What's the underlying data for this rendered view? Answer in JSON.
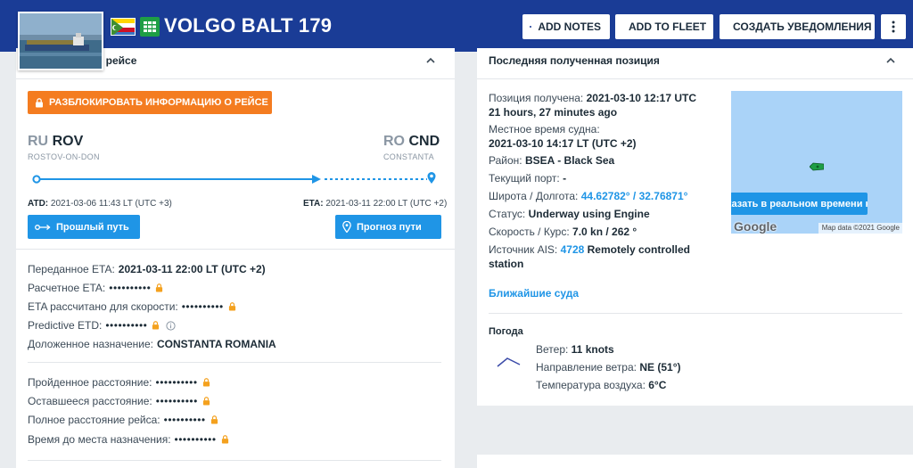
{
  "vessel": {
    "name": "VOLGO BALT 179"
  },
  "header_buttons": {
    "notes": "ADD NOTES",
    "fleet": "ADD TO FLEET",
    "alert": "СОЗДАТЬ УВЕДОМЛЕНИЯ"
  },
  "voyage": {
    "title_visible": "о рейсе",
    "unlock_label": "РАЗБЛОКИРОВАТЬ ИНФОРМАЦИЮ О РЕЙСЕ",
    "departure": {
      "country": "RU",
      "code": "ROV",
      "name": "ROSTOV-ON-DON"
    },
    "arrival": {
      "country": "RO",
      "code": "CND",
      "name": "CONSTANTA"
    },
    "atd_label": "ATD:",
    "atd_value": "2021-03-06 11:43 LT (UTC +3)",
    "eta_label": "ETA:",
    "eta_value": "2021-03-11 22:00 LT (UTC +2)",
    "past_track_label": "Прошлый путь",
    "forecast_label": "Прогноз пути",
    "fields": {
      "reported_eta_label": "Переданное ETA:",
      "reported_eta_value": "2021-03-11 22:00 LT (UTC +2)",
      "calc_eta_label": "Расчетное ETA:",
      "calc_speed_label": "ETA рассчитано для скорости:",
      "predictive_etd_label": "Predictive ETD:",
      "destination_label": "Доложенное назначение:",
      "destination_value": "CONSTANTA ROMANIA",
      "distance_travelled_label": "Пройденное расстояние:",
      "distance_remaining_label": "Оставшееся расстояние:",
      "total_distance_label": "Полное расстояние рейса:",
      "time_to_dest_label": "Время до места назначения:",
      "mask": "••••••••••"
    }
  },
  "position": {
    "title": "Последняя полученная позиция",
    "received_label": "Позиция получена:",
    "received_value": "2021-03-10 12:17 UTC",
    "received_ago": "21 hours, 27 minutes ago",
    "local_time_label": "Местное время судна:",
    "local_time_value": "2021-03-10 14:17 LT (UTC +2)",
    "area_label": "Район:",
    "area_value": "BSEA - Black Sea",
    "current_port_label": "Текущий порт:",
    "current_port_value": "-",
    "latlon_label": "Широта / Долгота:",
    "latlon_value": "44.62782° / 32.76871°",
    "status_label": "Статус:",
    "status_value": "Underway using Engine",
    "speed_label": "Скорость / Курс:",
    "speed_value": "7.0 kn / 262 °",
    "ais_label": "Источник AIS:",
    "ais_id": "4728",
    "ais_value_1": "Remotely controlled",
    "ais_value_2": "station",
    "nearby_label": "Ближайшие суда",
    "map_button": "казать в реальном времени на кар",
    "map_google": "Google",
    "map_attr": "Map data ©2021 Google"
  },
  "weather": {
    "title": "Погода",
    "wind_label": "Ветер:",
    "wind_value": "11 knots",
    "dir_label": "Направление ветра:",
    "dir_value": "NE (51°)",
    "temp_label": "Температура воздуха:",
    "temp_value": "6°C"
  },
  "colors": {
    "header": "#1a3c96",
    "accent_orange": "#f47c20",
    "accent_blue": "#1f95e6",
    "map_sea": "#aad3f8"
  }
}
